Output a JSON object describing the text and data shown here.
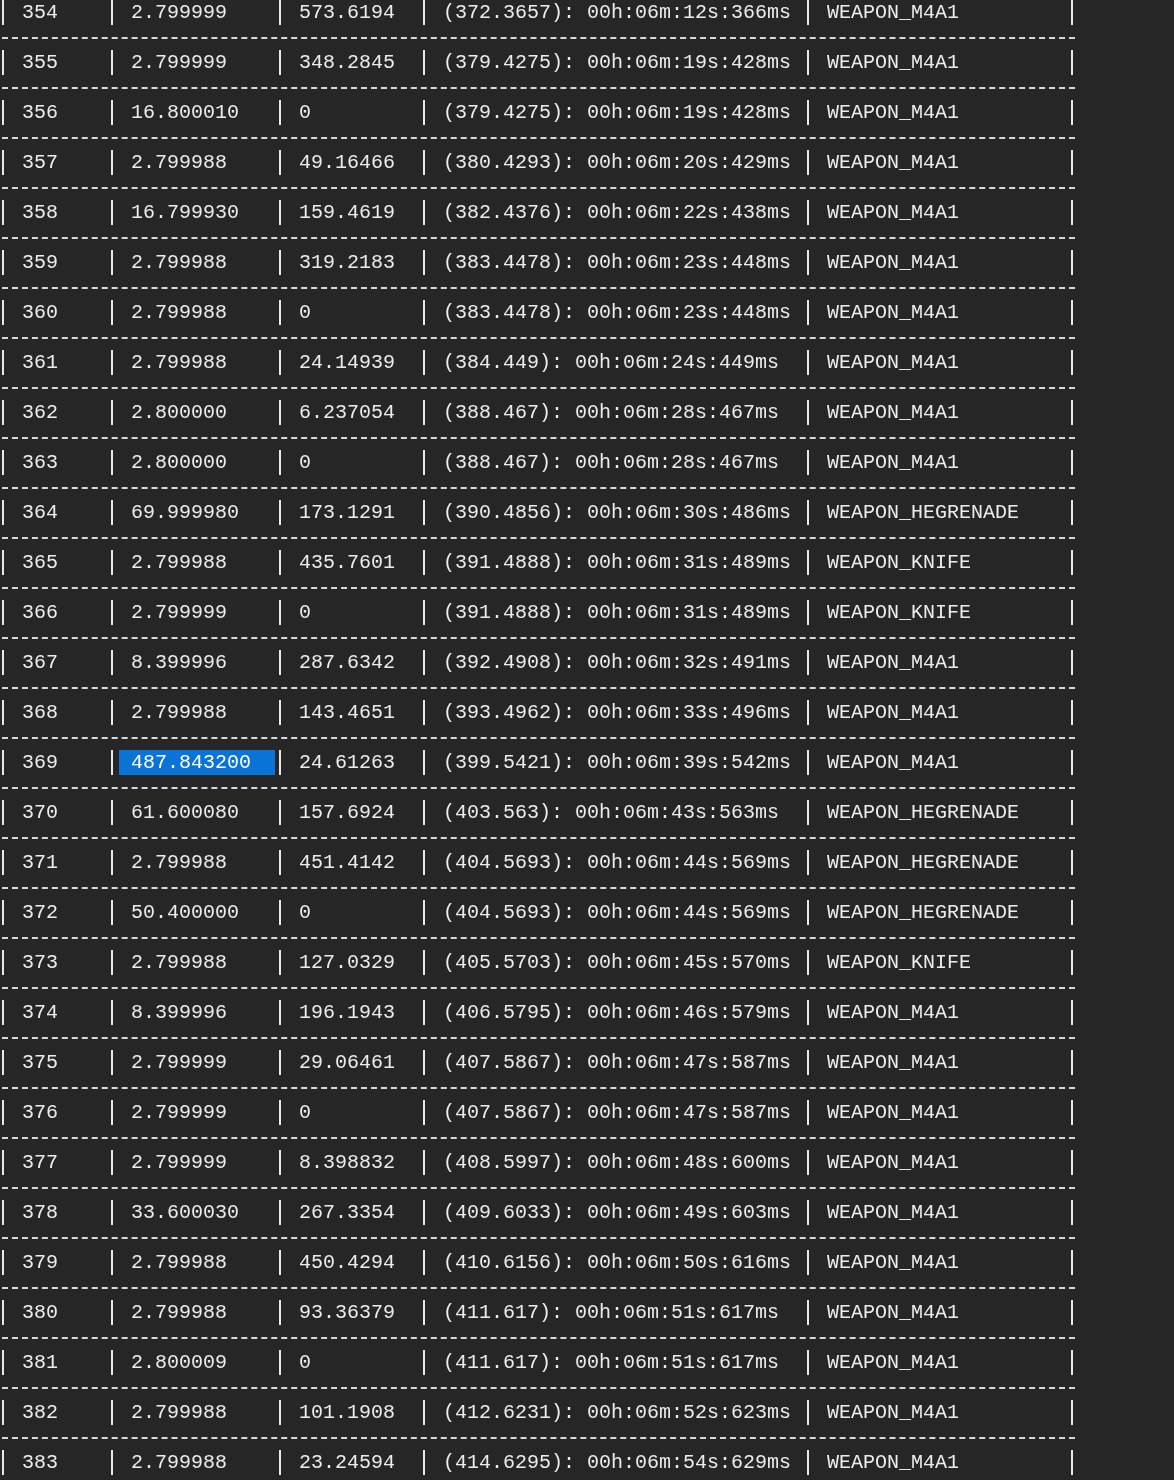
{
  "table": {
    "rows": [
      {
        "selected": false,
        "cells": [
          "354",
          "2.799999",
          "573.6194",
          "(372.3657): 00h:06m:12s:366ms",
          "WEAPON_M4A1"
        ]
      },
      {
        "selected": false,
        "cells": [
          "355",
          "2.799999",
          "348.2845",
          "(379.4275): 00h:06m:19s:428ms",
          "WEAPON_M4A1"
        ]
      },
      {
        "selected": false,
        "cells": [
          "356",
          "16.800010",
          "0",
          "(379.4275): 00h:06m:19s:428ms",
          "WEAPON_M4A1"
        ]
      },
      {
        "selected": false,
        "cells": [
          "357",
          "2.799988",
          "49.16466",
          "(380.4293): 00h:06m:20s:429ms",
          "WEAPON_M4A1"
        ]
      },
      {
        "selected": false,
        "cells": [
          "358",
          "16.799930",
          "159.4619",
          "(382.4376): 00h:06m:22s:438ms",
          "WEAPON_M4A1"
        ]
      },
      {
        "selected": false,
        "cells": [
          "359",
          "2.799988",
          "319.2183",
          "(383.4478): 00h:06m:23s:448ms",
          "WEAPON_M4A1"
        ]
      },
      {
        "selected": false,
        "cells": [
          "360",
          "2.799988",
          "0",
          "(383.4478): 00h:06m:23s:448ms",
          "WEAPON_M4A1"
        ]
      },
      {
        "selected": false,
        "cells": [
          "361",
          "2.799988",
          "24.14939",
          "(384.449): 00h:06m:24s:449ms",
          "WEAPON_M4A1"
        ]
      },
      {
        "selected": false,
        "cells": [
          "362",
          "2.800000",
          "6.237054",
          "(388.467): 00h:06m:28s:467ms",
          "WEAPON_M4A1"
        ]
      },
      {
        "selected": false,
        "cells": [
          "363",
          "2.800000",
          "0",
          "(388.467): 00h:06m:28s:467ms",
          "WEAPON_M4A1"
        ]
      },
      {
        "selected": false,
        "cells": [
          "364",
          "69.999980",
          "173.1291",
          "(390.4856): 00h:06m:30s:486ms",
          "WEAPON_HEGRENADE"
        ]
      },
      {
        "selected": false,
        "cells": [
          "365",
          "2.799988",
          "435.7601",
          "(391.4888): 00h:06m:31s:489ms",
          "WEAPON_KNIFE"
        ]
      },
      {
        "selected": false,
        "cells": [
          "366",
          "2.799999",
          "0",
          "(391.4888): 00h:06m:31s:489ms",
          "WEAPON_KNIFE"
        ]
      },
      {
        "selected": false,
        "cells": [
          "367",
          "8.399996",
          "287.6342",
          "(392.4908): 00h:06m:32s:491ms",
          "WEAPON_M4A1"
        ]
      },
      {
        "selected": false,
        "cells": [
          "368",
          "2.799988",
          "143.4651",
          "(393.4962): 00h:06m:33s:496ms",
          "WEAPON_M4A1"
        ]
      },
      {
        "selected": true,
        "cells": [
          "369",
          "487.843200",
          "24.61263",
          "(399.5421): 00h:06m:39s:542ms",
          "WEAPON_M4A1"
        ]
      },
      {
        "selected": false,
        "cells": [
          "370",
          "61.600080",
          "157.6924",
          "(403.563): 00h:06m:43s:563ms",
          "WEAPON_HEGRENADE"
        ]
      },
      {
        "selected": false,
        "cells": [
          "371",
          "2.799988",
          "451.4142",
          "(404.5693): 00h:06m:44s:569ms",
          "WEAPON_HEGRENADE"
        ]
      },
      {
        "selected": false,
        "cells": [
          "372",
          "50.400000",
          "0",
          "(404.5693): 00h:06m:44s:569ms",
          "WEAPON_HEGRENADE"
        ]
      },
      {
        "selected": false,
        "cells": [
          "373",
          "2.799988",
          "127.0329",
          "(405.5703): 00h:06m:45s:570ms",
          "WEAPON_KNIFE"
        ]
      },
      {
        "selected": false,
        "cells": [
          "374",
          "8.399996",
          "196.1943",
          "(406.5795): 00h:06m:46s:579ms",
          "WEAPON_M4A1"
        ]
      },
      {
        "selected": false,
        "cells": [
          "375",
          "2.799999",
          "29.06461",
          "(407.5867): 00h:06m:47s:587ms",
          "WEAPON_M4A1"
        ]
      },
      {
        "selected": false,
        "cells": [
          "376",
          "2.799999",
          "0",
          "(407.5867): 00h:06m:47s:587ms",
          "WEAPON_M4A1"
        ]
      },
      {
        "selected": false,
        "cells": [
          "377",
          "2.799999",
          "8.398832",
          "(408.5997): 00h:06m:48s:600ms",
          "WEAPON_M4A1"
        ]
      },
      {
        "selected": false,
        "cells": [
          "378",
          "33.600030",
          "267.3354",
          "(409.6033): 00h:06m:49s:603ms",
          "WEAPON_M4A1"
        ]
      },
      {
        "selected": false,
        "cells": [
          "379",
          "2.799988",
          "450.4294",
          "(410.6156): 00h:06m:50s:616ms",
          "WEAPON_M4A1"
        ]
      },
      {
        "selected": false,
        "cells": [
          "380",
          "2.799988",
          "93.36379",
          "(411.617): 00h:06m:51s:617ms",
          "WEAPON_M4A1"
        ]
      },
      {
        "selected": false,
        "cells": [
          "381",
          "2.800009",
          "0",
          "(411.617): 00h:06m:51s:617ms",
          "WEAPON_M4A1"
        ]
      },
      {
        "selected": false,
        "cells": [
          "382",
          "2.799988",
          "101.1908",
          "(412.6231): 00h:06m:52s:623ms",
          "WEAPON_M4A1"
        ]
      },
      {
        "selected": false,
        "cells": [
          "383",
          "2.799988",
          "23.24594",
          "(414.6295): 00h:06m:54s:629ms",
          "WEAPON_M4A1"
        ]
      }
    ]
  }
}
